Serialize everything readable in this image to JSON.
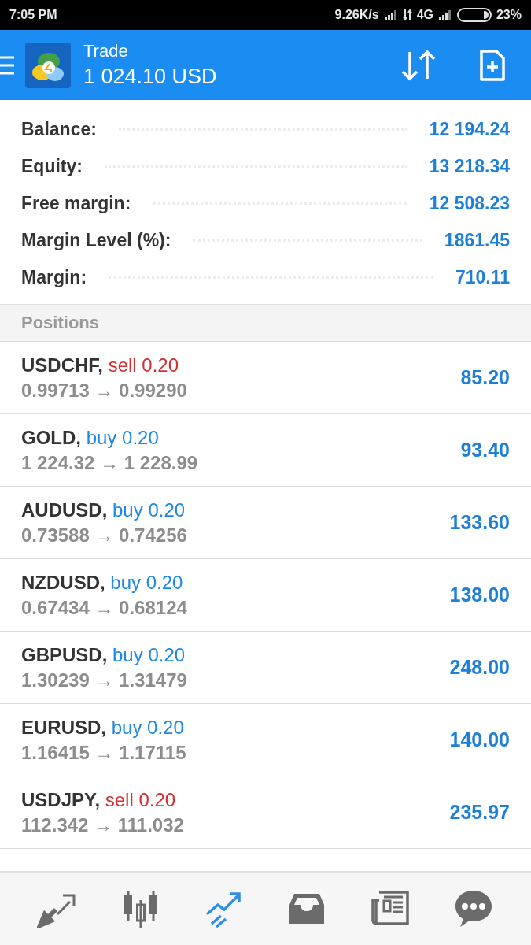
{
  "status_bar": {
    "time": "7:05 PM",
    "speed": "9.26K/s",
    "network": "4G",
    "battery": "23%"
  },
  "header": {
    "title": "Trade",
    "balance": "1 024.10 USD"
  },
  "summary": [
    {
      "label": "Balance:",
      "value": "12 194.24"
    },
    {
      "label": "Equity:",
      "value": "13 218.34"
    },
    {
      "label": "Free margin:",
      "value": "12 508.23"
    },
    {
      "label": "Margin Level (%):",
      "value": "1861.45"
    },
    {
      "label": "Margin:",
      "value": "710.11"
    }
  ],
  "positions_heading": "Positions",
  "positions": [
    {
      "symbol": "USDCHF,",
      "kind": "sell",
      "order": "sell 0.20",
      "prices": "0.99713 → 0.99290",
      "profit": "85.20"
    },
    {
      "symbol": "GOLD,",
      "kind": "buy",
      "order": "buy 0.20",
      "prices": "1 224.32 → 1 228.99",
      "profit": "93.40"
    },
    {
      "symbol": "AUDUSD,",
      "kind": "buy",
      "order": "buy 0.20",
      "prices": "0.73588 → 0.74256",
      "profit": "133.60"
    },
    {
      "symbol": "NZDUSD,",
      "kind": "buy",
      "order": "buy 0.20",
      "prices": "0.67434 → 0.68124",
      "profit": "138.00"
    },
    {
      "symbol": "GBPUSD,",
      "kind": "buy",
      "order": "buy 0.20",
      "prices": "1.30239 → 1.31479",
      "profit": "248.00"
    },
    {
      "symbol": "EURUSD,",
      "kind": "buy",
      "order": "buy 0.20",
      "prices": "1.16415 → 1.17115",
      "profit": "140.00"
    },
    {
      "symbol": "USDJPY,",
      "kind": "sell",
      "order": "sell 0.20",
      "prices": "112.342 → 111.032",
      "profit": "235.97"
    }
  ],
  "nav": [
    {
      "kind": "quotes",
      "selected": false
    },
    {
      "kind": "chart",
      "selected": false
    },
    {
      "kind": "trade",
      "selected": true
    },
    {
      "kind": "history",
      "selected": false
    },
    {
      "kind": "news",
      "selected": false
    },
    {
      "kind": "messages",
      "selected": false
    }
  ]
}
